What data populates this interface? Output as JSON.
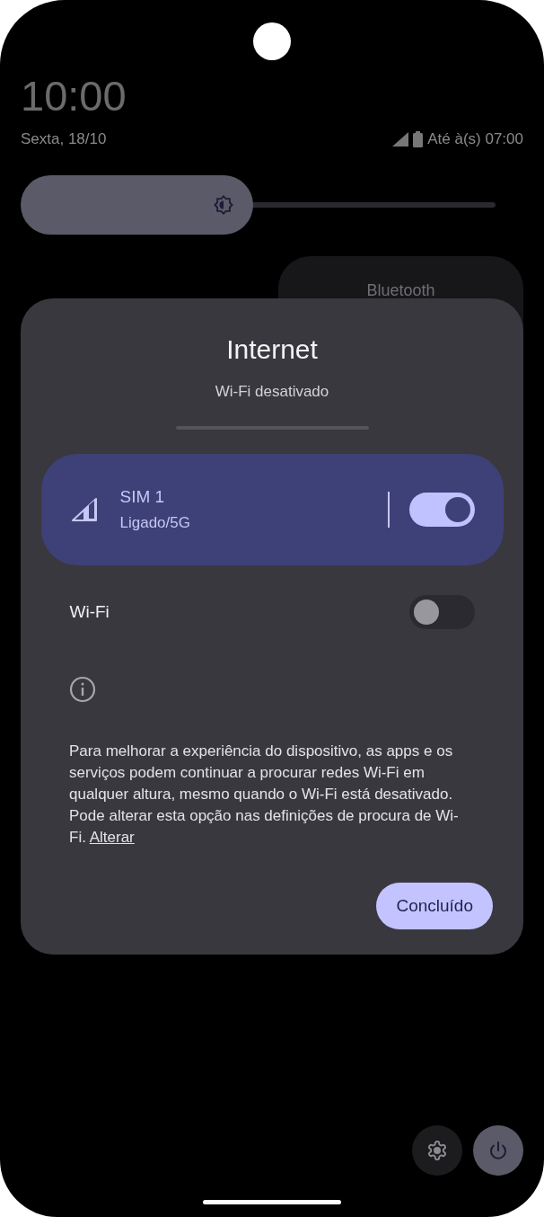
{
  "status": {
    "time": "10:00",
    "date": "Sexta, 18/10",
    "battery_text": "Até à(s) 07:00"
  },
  "brightness": {
    "level": 0.49
  },
  "tiles": [
    {
      "label": "Bluetooth"
    }
  ],
  "dialog": {
    "title": "Internet",
    "subtitle": "Wi-Fi desativado",
    "networks": [
      {
        "kind": "sim",
        "name": "SIM 1",
        "detail": "Ligado/5G",
        "on": true,
        "selected": true
      },
      {
        "kind": "wifi",
        "name": "Wi-Fi",
        "on": false,
        "selected": false
      }
    ],
    "info_text": "Para melhorar a experiência do dispositivo, as apps e os serviços podem continuar a procurar redes Wi-Fi em qualquer altura, mesmo quando o Wi-Fi está desativado. Pode alterar esta opção nas definições de procura de Wi-Fi.",
    "info_link": "Alterar",
    "done_button": "Concluído"
  }
}
